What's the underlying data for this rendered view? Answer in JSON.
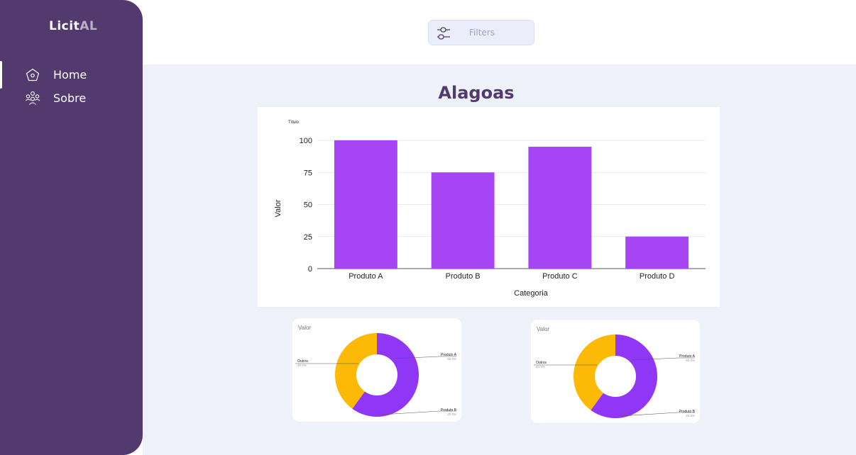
{
  "app": {
    "brand_part1": "Licit",
    "brand_part2": "AL"
  },
  "sidebar": {
    "items": [
      {
        "label": "Home",
        "icon": "home-icon",
        "active": true
      },
      {
        "label": "Sobre",
        "icon": "group-icon",
        "active": false
      }
    ]
  },
  "toolbar": {
    "filter_label": "Filters",
    "filter_icon": "sliders-icon"
  },
  "page": {
    "title": "Alagoas"
  },
  "colors": {
    "sidebar": "#523a6f",
    "bar": "#a745f5",
    "pie_primary": "#9037f7",
    "pie_secondary": "#fcb905",
    "content_bg": "#eef0fa"
  },
  "chart_data": [
    {
      "type": "bar",
      "title": "Título",
      "xlabel": "Categoria",
      "ylabel": "Valor",
      "categories": [
        "Produto A",
        "Produto B",
        "Produto C",
        "Produto D"
      ],
      "values": [
        100,
        75,
        95,
        25
      ],
      "ylim": [
        0,
        100
      ],
      "yticks": [
        0,
        25,
        50,
        75,
        100
      ],
      "grid": true
    },
    {
      "type": "pie",
      "subtype": "donut",
      "title": "Valor",
      "slices": [
        {
          "label": "Produto A",
          "value": 60,
          "pct_label": "60.0%"
        },
        {
          "label": "Outros",
          "value": 40,
          "pct_label": "40.0%"
        }
      ],
      "extra_labels": [
        {
          "label": "Produto B",
          "pct_label": "20.0%"
        }
      ]
    },
    {
      "type": "pie",
      "subtype": "donut",
      "title": "Valor",
      "slices": [
        {
          "label": "Produto A",
          "value": 60,
          "pct_label": "60.0%"
        },
        {
          "label": "Outros",
          "value": 40,
          "pct_label": "40.0%"
        }
      ],
      "extra_labels": [
        {
          "label": "Produto B",
          "pct_label": "20.0%"
        }
      ]
    }
  ]
}
